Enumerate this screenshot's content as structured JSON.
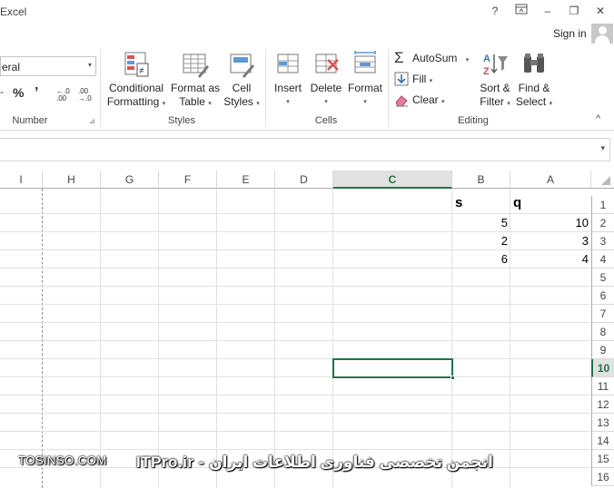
{
  "window": {
    "title": "Excel",
    "help": "?",
    "restore_ribbon": "⊡",
    "minimize": "–",
    "maximize": "❐",
    "close": "✕"
  },
  "account": {
    "signin": "Sign in"
  },
  "ribbon": {
    "number": {
      "format_value": "eral",
      "percent": "%",
      "comma": "’",
      "currency_fragment": "-",
      "increase_decimal": "←.0 .00",
      "decrease_decimal": ".00 →.0",
      "label": "Number"
    },
    "styles": {
      "conditional_line1": "Conditional",
      "conditional_line2": "Formatting",
      "format_table_line1": "Format as",
      "format_table_line2": "Table",
      "cell_styles_line1": "Cell",
      "cell_styles_line2": "Styles",
      "label": "Styles"
    },
    "cells": {
      "insert": "Insert",
      "delete": "Delete",
      "format": "Format",
      "label": "Cells"
    },
    "editing": {
      "autosum": "AutoSum",
      "fill": "Fill",
      "clear": "Clear",
      "sort_line1": "Sort &",
      "sort_line2": "Filter",
      "find_line1": "Find &",
      "find_line2": "Select",
      "label": "Editing"
    },
    "caret": "▾",
    "collapse": "^"
  },
  "sheet": {
    "columns": [
      "I",
      "H",
      "G",
      "F",
      "E",
      "D",
      "C",
      "B",
      "A"
    ],
    "selected_column": "C",
    "rows": [
      "1",
      "2",
      "3",
      "4",
      "5",
      "6",
      "7",
      "8",
      "9",
      "10",
      "11",
      "12",
      "13",
      "14",
      "15",
      "16"
    ],
    "selected_row": "10",
    "cells": {
      "A1": "q",
      "B1": "s",
      "A2": "10",
      "B2": "5",
      "A3": "3",
      "B3": "2",
      "A4": "4",
      "B4": "6"
    }
  },
  "watermark": {
    "right": "ITPro.ir - انجمن تخصصی فناوری اطلاعات ایران",
    "left": "TOSINSO.COM"
  }
}
